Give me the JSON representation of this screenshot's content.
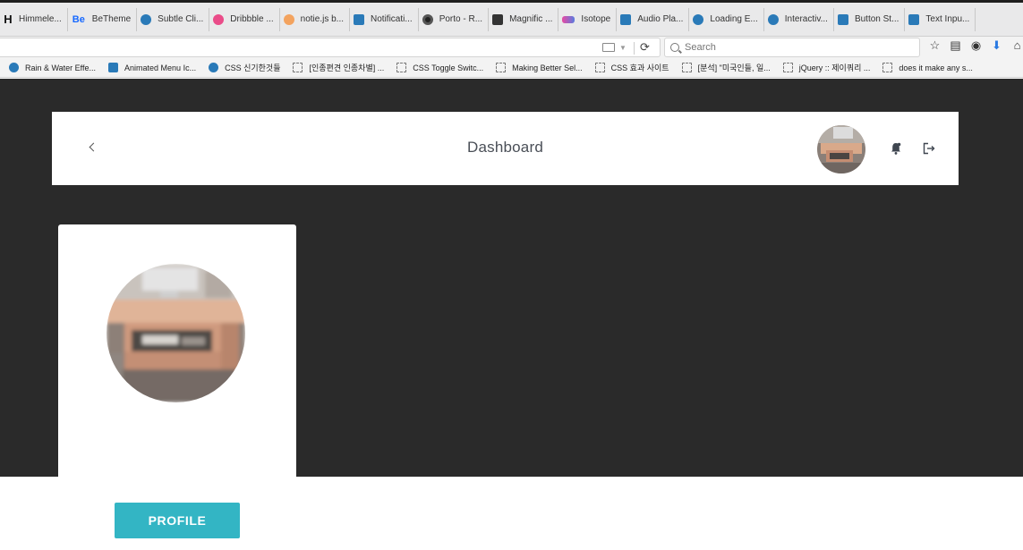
{
  "browser": {
    "tabs": [
      {
        "label": "Himmele...",
        "icon": "h-logo-icon"
      },
      {
        "label": "BeTheme",
        "icon": "behance-icon"
      },
      {
        "label": "Subtle Cli...",
        "icon": "droplet-icon"
      },
      {
        "label": "Dribbble ...",
        "icon": "dribbble-icon"
      },
      {
        "label": "notie.js b...",
        "icon": "notie-icon"
      },
      {
        "label": "Notificati...",
        "icon": "codrops-icon"
      },
      {
        "label": "Porto - R...",
        "icon": "porto-icon"
      },
      {
        "label": "Magnific ...",
        "icon": "magnific-icon"
      },
      {
        "label": "Isotope",
        "icon": "isotope-icon"
      },
      {
        "label": "Audio Pla...",
        "icon": "codrops-icon"
      },
      {
        "label": "Loading E...",
        "icon": "droplet-icon"
      },
      {
        "label": "Interactiv...",
        "icon": "droplet-icon"
      },
      {
        "label": "Button St...",
        "icon": "codrops-icon"
      },
      {
        "label": "Text Inpu...",
        "icon": "codrops-icon"
      }
    ],
    "search_placeholder": "Search",
    "bookmarks": [
      {
        "label": "Rain & Water Effe...",
        "icon": "droplet-icon"
      },
      {
        "label": "Animated Menu Ic...",
        "icon": "codrops-icon"
      },
      {
        "label": "CSS 신기한것들",
        "icon": "droplet-icon"
      },
      {
        "label": "[인종편견 인종차별] ...",
        "icon": "page-icon"
      },
      {
        "label": "CSS Toggle Switc...",
        "icon": "page-icon"
      },
      {
        "label": "Making Better Sel...",
        "icon": "page-icon"
      },
      {
        "label": "CSS 효과 사이트",
        "icon": "page-icon"
      },
      {
        "label": "[분석] \"미국인들, 일...",
        "icon": "page-icon"
      },
      {
        "label": "jQuery :: 제이쿼리 ...",
        "icon": "page-icon"
      },
      {
        "label": "does it make any s...",
        "icon": "page-icon"
      }
    ]
  },
  "header": {
    "title": "Dashboard"
  },
  "profile": {
    "button_label": "PROFILE"
  },
  "colors": {
    "page_background": "#2a2a2a",
    "accent": "#33b5c4",
    "title_text": "#4a4f57"
  }
}
